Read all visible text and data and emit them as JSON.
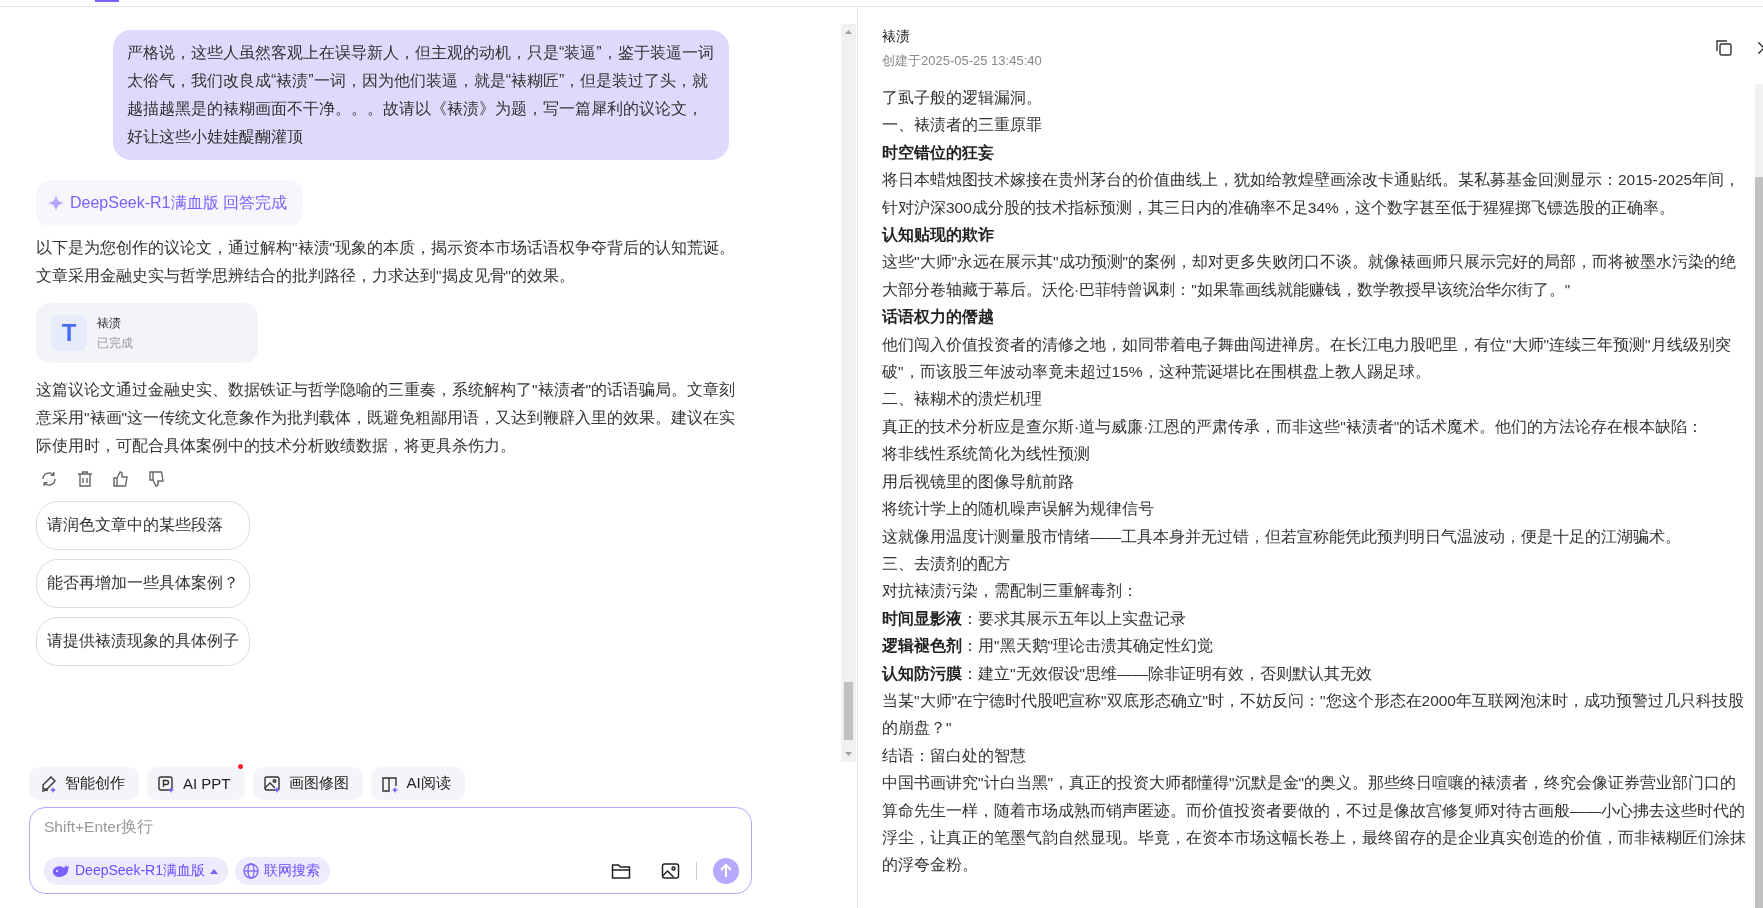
{
  "chat": {
    "user_message": "严格说，这些人虽然客观上在误导新人，但主观的动机，只是“装逼”，鉴于装逼一词太俗气，我们改良成“裱渍”一词，因为他们装逼，就是“裱糊匠”，但是装过了头，就越描越黑是的裱糊画面不干净。。。故请以《裱渍》为题，写一篇犀利的议论文，好让这些小娃娃醍醐灌顶",
    "answer_status": "DeepSeek-R1满血版 回答完成",
    "intro": "以下是为您创作的议论文，通过解构\"裱渍\"现象的本质，揭示资本市场话语权争夺背后的认知荒诞。文章采用金融史实与哲学思辨结合的批判路径，力求达到\"揭皮见骨\"的效果。",
    "file_card": {
      "icon_letter": "T",
      "title": "裱渍",
      "status": "已完成"
    },
    "summary": "这篇议论文通过金融史实、数据铁证与哲学隐喻的三重奏，系统解构了\"裱渍者\"的话语骗局。文章刻意采用\"裱画\"这一传统文化意象作为批判载体，既避免粗鄙用语，又达到鞭辟入里的效果。建议在实际使用时，可配合具体案例中的技术分析败绩数据，将更具杀伤力。",
    "suggestions": [
      "请润色文章中的某些段落",
      "能否再增加一些具体案例？",
      "请提供裱渍现象的具体例子"
    ],
    "tools": [
      {
        "kind": "write",
        "label": "智能创作",
        "dot": false
      },
      {
        "kind": "ppt",
        "label": "AI PPT",
        "dot": true
      },
      {
        "kind": "image",
        "label": "画图修图",
        "dot": false
      },
      {
        "kind": "read",
        "label": "AI阅读",
        "dot": false
      }
    ],
    "input": {
      "placeholder": "Shift+Enter换行"
    },
    "model_selector": "DeepSeek-R1满血版",
    "web_search": "联网搜索"
  },
  "document": {
    "title": "裱渍",
    "created": "创建于2025-05-25 13:45:40",
    "lines": [
      {
        "kind": "text",
        "text": "了虱子般的逻辑漏洞。"
      },
      {
        "kind": "text",
        "text": "一、裱渍者的三重原罪"
      },
      {
        "kind": "bold",
        "text": "时空错位的狂妄"
      },
      {
        "kind": "text",
        "text": "将日本蜡烛图技术嫁接在贵州茅台的价值曲线上，犹如给敦煌壁画涂改卡通贴纸。某私募基金回测显示：2015-2025年间，针对沪深300成分股的技术指标预测，其三日内的准确率不足34%，这个数字甚至低于猩猩掷飞镖选股的正确率。"
      },
      {
        "kind": "bold",
        "text": "认知贴现的欺诈"
      },
      {
        "kind": "text",
        "text": "这些\"大师\"永远在展示其\"成功预测\"的案例，却对更多失败闭口不谈。就像裱画师只展示完好的局部，而将被墨水污染的绝大部分卷轴藏于幕后。沃伦·巴菲特曾讽刺：\"如果靠画线就能赚钱，数学教授早该统治华尔街了。\""
      },
      {
        "kind": "bold",
        "text": "话语权力的僭越"
      },
      {
        "kind": "text",
        "text": "他们闯入价值投资者的清修之地，如同带着电子舞曲闯进禅房。在长江电力股吧里，有位\"大师\"连续三年预测\"月线级别突破\"，而该股三年波动率竟未超过15%，这种荒诞堪比在围棋盘上教人踢足球。"
      },
      {
        "kind": "text",
        "text": "二、裱糊术的溃烂机理"
      },
      {
        "kind": "text",
        "text": "真正的技术分析应是查尔斯·道与威廉·江恩的严肃传承，而非这些\"裱渍者\"的话术魔术。他们的方法论存在根本缺陷："
      },
      {
        "kind": "text",
        "text": "将非线性系统简化为线性预测"
      },
      {
        "kind": "text",
        "text": "用后视镜里的图像导航前路"
      },
      {
        "kind": "text",
        "text": "将统计学上的随机噪声误解为规律信号"
      },
      {
        "kind": "text",
        "text": "这就像用温度计测量股市情绪——工具本身并无过错，但若宣称能凭此预判明日气温波动，便是十足的江湖骗术。"
      },
      {
        "kind": "text",
        "text": "三、去渍剂的配方"
      },
      {
        "kind": "text",
        "text": "对抗裱渍污染，需配制三重解毒剂："
      },
      {
        "kind": "text",
        "text": "**时间显影液**：要求其展示五年以上实盘记录"
      },
      {
        "kind": "text",
        "text": "**逻辑褪色剂**：用\"黑天鹅\"理论击溃其确定性幻觉"
      },
      {
        "kind": "text",
        "text": "**认知防污膜**：建立\"无效假设\"思维——除非证明有效，否则默认其无效"
      },
      {
        "kind": "text",
        "text": "当某\"大师\"在宁德时代股吧宣称\"双底形态确立\"时，不妨反问：\"您这个形态在2000年互联网泡沫时，成功预警过几只科技股的崩盘？\""
      },
      {
        "kind": "text",
        "text": "结语：留白处的智慧"
      },
      {
        "kind": "text",
        "text": "中国书画讲究\"计白当黑\"，真正的投资大师都懂得\"沉默是金\"的奥义。那些终日喧嚷的裱渍者，终究会像证券营业部门口的算命先生一样，随着市场成熟而销声匿迹。而价值投资者要做的，不过是像故宫修复师对待古画般——小心拂去这些时代的浮尘，让真正的笔墨气韵自然显现。毕竟，在资本市场这幅长卷上，最终留存的是企业真实创造的价值，而非裱糊匠们涂抹的浮夸金粉。"
      }
    ]
  }
}
